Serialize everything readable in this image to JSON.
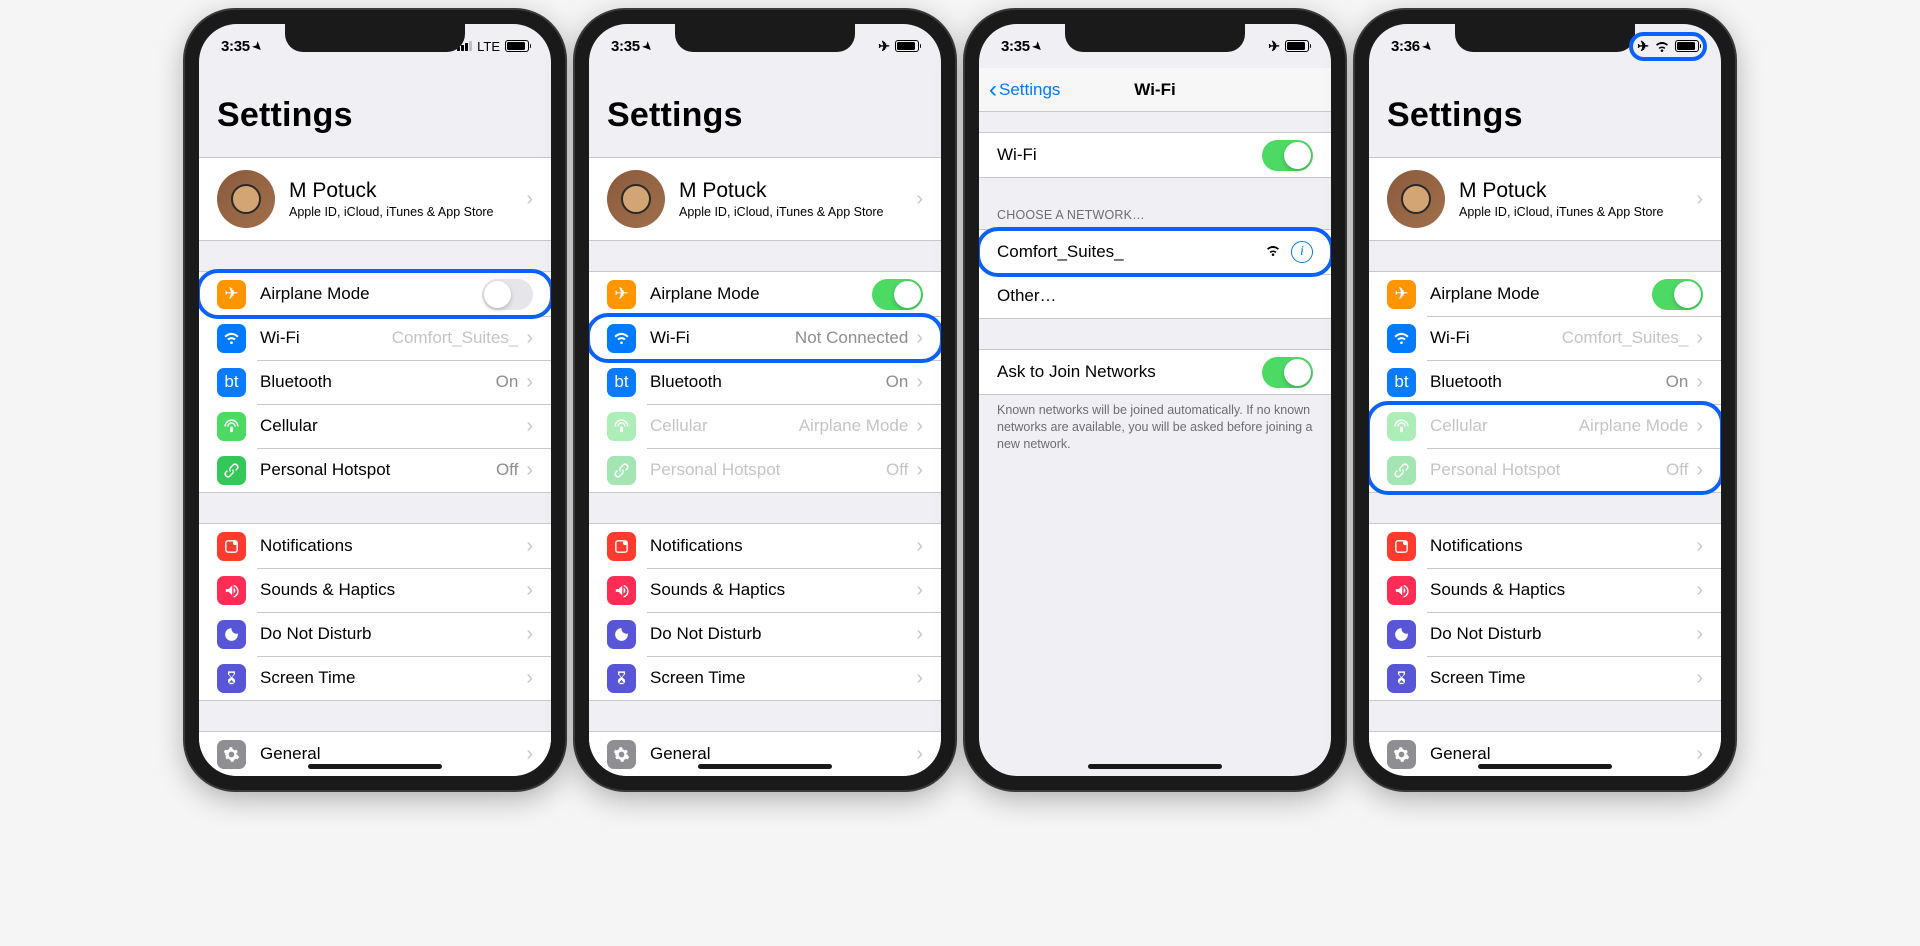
{
  "phones": [
    {
      "time": "3:35",
      "status_right": {
        "net": "LTE",
        "plane": false,
        "wifi": false,
        "bars": true
      },
      "view": "settings",
      "settings_title": "Settings",
      "profile": {
        "name": "M Potuck",
        "sub": "Apple ID, iCloud, iTunes & App Store"
      },
      "rows1": [
        {
          "icon": "airplane",
          "label": "Airplane Mode",
          "value": "",
          "toggle": "off",
          "dim": false,
          "highlight": true
        },
        {
          "icon": "wifi",
          "label": "Wi-Fi",
          "value": "Comfort_Suites_",
          "chev": true,
          "dim_value": true
        },
        {
          "icon": "bt",
          "label": "Bluetooth",
          "value": "On",
          "chev": true
        },
        {
          "icon": "cell",
          "label": "Cellular",
          "value": "",
          "chev": true
        },
        {
          "icon": "hotspot",
          "label": "Personal Hotspot",
          "value": "Off",
          "chev": true
        }
      ],
      "rows2": [
        {
          "icon": "notif",
          "label": "Notifications",
          "chev": true
        },
        {
          "icon": "sound",
          "label": "Sounds & Haptics",
          "chev": true
        },
        {
          "icon": "dnd",
          "label": "Do Not Disturb",
          "chev": true
        },
        {
          "icon": "st",
          "label": "Screen Time",
          "chev": true
        }
      ],
      "rows3": [
        {
          "icon": "gear",
          "label": "General",
          "chev": true
        }
      ]
    },
    {
      "time": "3:35",
      "status_right": {
        "plane": true
      },
      "view": "settings",
      "settings_title": "Settings",
      "profile": {
        "name": "M Potuck",
        "sub": "Apple ID, iCloud, iTunes & App Store"
      },
      "rows1": [
        {
          "icon": "airplane",
          "label": "Airplane Mode",
          "toggle": "on"
        },
        {
          "icon": "wifi",
          "label": "Wi-Fi",
          "value": "Not Connected",
          "chev": true,
          "highlight": true
        },
        {
          "icon": "bt",
          "label": "Bluetooth",
          "value": "On",
          "chev": true
        },
        {
          "icon": "cell",
          "label": "Cellular",
          "value": "Airplane Mode",
          "chev": true,
          "dim": true
        },
        {
          "icon": "hotspot",
          "label": "Personal Hotspot",
          "value": "Off",
          "chev": true,
          "dim": true
        }
      ],
      "rows2": [
        {
          "icon": "notif",
          "label": "Notifications",
          "chev": true
        },
        {
          "icon": "sound",
          "label": "Sounds & Haptics",
          "chev": true
        },
        {
          "icon": "dnd",
          "label": "Do Not Disturb",
          "chev": true
        },
        {
          "icon": "st",
          "label": "Screen Time",
          "chev": true
        }
      ],
      "rows3": [
        {
          "icon": "gear",
          "label": "General",
          "chev": true
        }
      ]
    },
    {
      "time": "3:35",
      "status_right": {
        "plane": true
      },
      "view": "wifi",
      "nav": {
        "back": "Settings",
        "title": "Wi-Fi"
      },
      "wifi_toggle_label": "Wi-Fi",
      "choose_header": "Choose a Network…",
      "networks": [
        {
          "ssid": "Comfort_Suites_",
          "highlight": true
        }
      ],
      "other_label": "Other…",
      "ask_label": "Ask to Join Networks",
      "ask_footer": "Known networks will be joined automatically. If no known networks are available, you will be asked before joining a new network."
    },
    {
      "time": "3:36",
      "status_right": {
        "plane": true,
        "wifi": true,
        "highlight": true
      },
      "view": "settings",
      "settings_title": "Settings",
      "profile": {
        "name": "M Potuck",
        "sub": "Apple ID, iCloud, iTunes & App Store"
      },
      "rows1": [
        {
          "icon": "airplane",
          "label": "Airplane Mode",
          "toggle": "on"
        },
        {
          "icon": "wifi",
          "label": "Wi-Fi",
          "value": "Comfort_Suites_",
          "chev": true,
          "dim_value": true
        },
        {
          "icon": "bt",
          "label": "Bluetooth",
          "value": "On",
          "chev": true
        },
        {
          "icon": "cell",
          "label": "Cellular",
          "value": "Airplane Mode",
          "chev": true,
          "dim": true,
          "hl_group_start": true
        },
        {
          "icon": "hotspot",
          "label": "Personal Hotspot",
          "value": "Off",
          "chev": true,
          "dim": true
        }
      ],
      "rows2": [
        {
          "icon": "notif",
          "label": "Notifications",
          "chev": true
        },
        {
          "icon": "sound",
          "label": "Sounds & Haptics",
          "chev": true
        },
        {
          "icon": "dnd",
          "label": "Do Not Disturb",
          "chev": true
        },
        {
          "icon": "st",
          "label": "Screen Time",
          "chev": true
        }
      ],
      "rows3": [
        {
          "icon": "gear",
          "label": "General",
          "chev": true
        }
      ],
      "group_highlight": {
        "start": 3,
        "count": 2
      }
    }
  ],
  "icon_map": {
    "airplane": {
      "cls": "icon-orange",
      "sym": "✈"
    },
    "wifi": {
      "cls": "icon-blue",
      "sym": "wifi"
    },
    "bt": {
      "cls": "icon-blue2",
      "sym": "bt"
    },
    "cell": {
      "cls": "icon-green",
      "sym": "cell"
    },
    "hotspot": {
      "cls": "icon-green2",
      "sym": "link"
    },
    "notif": {
      "cls": "icon-red",
      "sym": "notif"
    },
    "sound": {
      "cls": "icon-red2",
      "sym": "vol"
    },
    "dnd": {
      "cls": "icon-indigo",
      "sym": "moon"
    },
    "st": {
      "cls": "icon-indigo",
      "sym": "hour"
    },
    "gear": {
      "cls": "icon-grey",
      "sym": "gear"
    }
  }
}
